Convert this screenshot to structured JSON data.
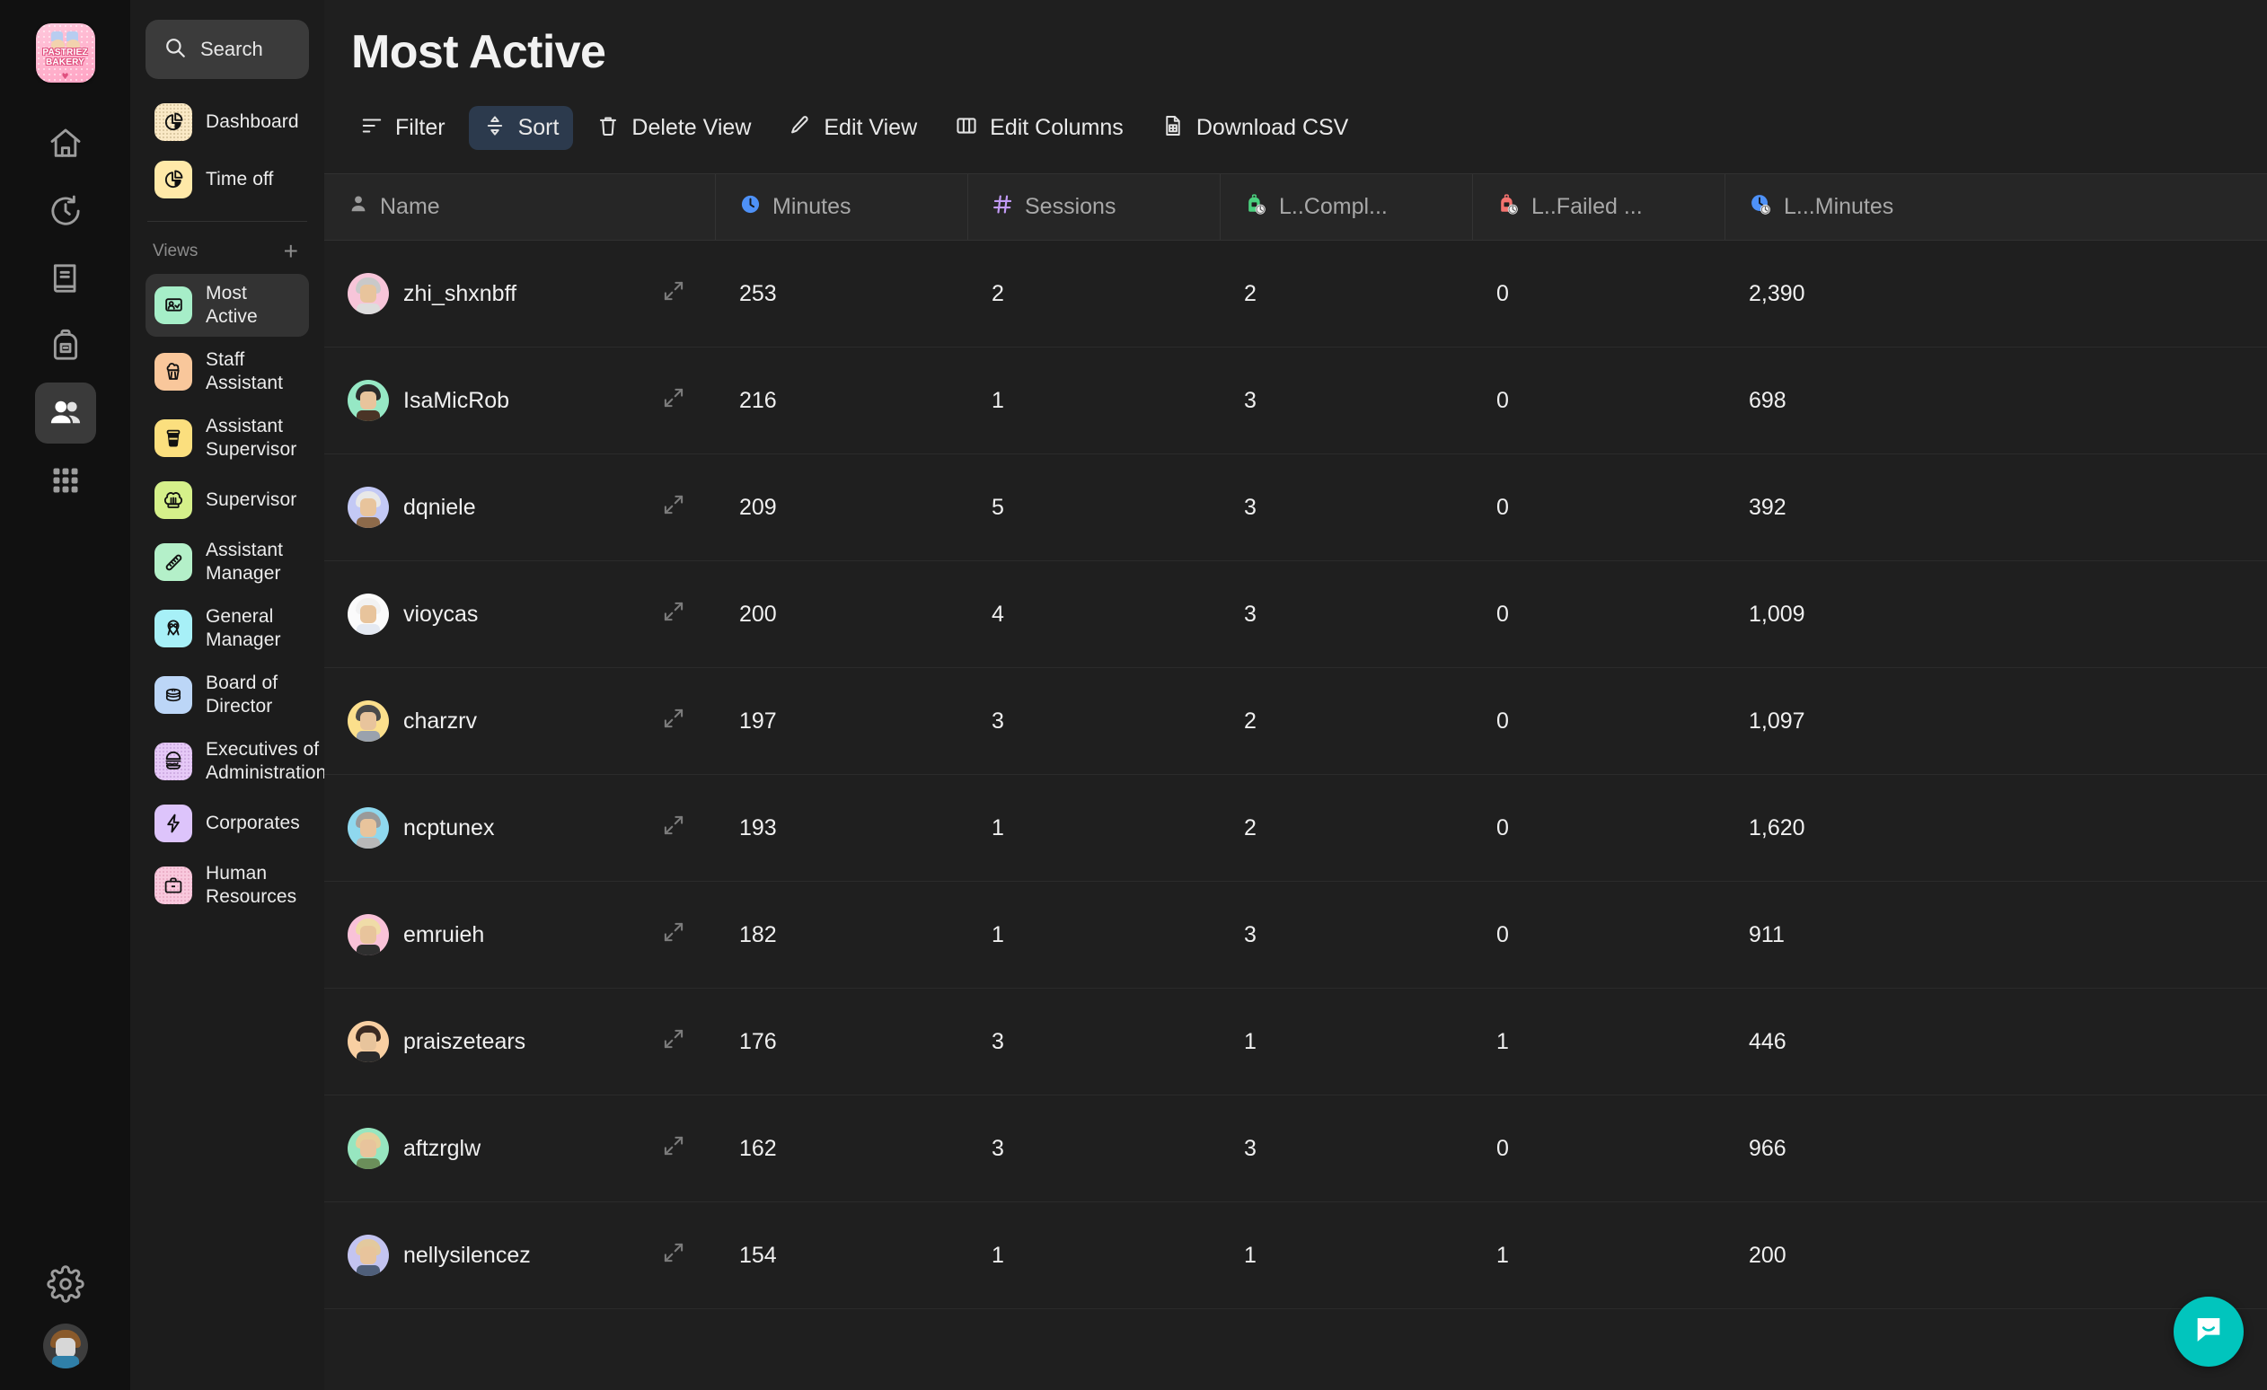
{
  "rail": {
    "brand": {
      "name": "brand-logo",
      "line1": "PASTRIEZ",
      "line2": "BAKERY"
    },
    "items": [
      {
        "name": "home-icon",
        "active": false
      },
      {
        "name": "timer-icon",
        "active": false
      },
      {
        "name": "book-icon",
        "active": false
      },
      {
        "name": "backpack-icon",
        "active": false
      },
      {
        "name": "people-icon",
        "active": true
      },
      {
        "name": "grid-apps-icon",
        "active": false
      }
    ],
    "settings": {
      "name": "gear-icon"
    },
    "avatar": {
      "name": "user-avatar"
    }
  },
  "search": {
    "placeholder": "Search",
    "icon": "search-icon"
  },
  "sidebar": {
    "nav": [
      {
        "label": "Dashboard",
        "icon": "pie-chart-icon",
        "tile": "#fae9c6",
        "textured": true
      },
      {
        "label": "Time off",
        "icon": "pie-chart-icon",
        "tile": "#ffe9a8",
        "textured": false
      }
    ],
    "views_header": {
      "label": "Views",
      "add_label": "+"
    },
    "views": [
      {
        "label": "Most Active",
        "icon": "user-presentation-icon",
        "tile": "#a6eec8",
        "selected": true
      },
      {
        "label": "Staff Assistant",
        "icon": "cupcake-icon",
        "tile": "#f9c79b",
        "selected": false
      },
      {
        "label": "Assistant Supervisor",
        "icon": "coffee-cup-icon",
        "tile": "#fbdf7e",
        "selected": false
      },
      {
        "label": "Supervisor",
        "icon": "chef-hat-icon",
        "tile": "#d5f08a",
        "selected": false
      },
      {
        "label": "Assistant Manager",
        "icon": "baguette-icon",
        "tile": "#b4f0c9",
        "selected": false
      },
      {
        "label": "General Manager",
        "icon": "location-pins-icon",
        "tile": "#a7f0f7",
        "selected": false
      },
      {
        "label": "Board of Director",
        "icon": "pancakes-icon",
        "tile": "#bcd6f7",
        "selected": false
      },
      {
        "label": "Executives of Administration",
        "icon": "burger-icon",
        "tile": "#e6c9f7",
        "selected": false
      },
      {
        "label": "Corporates",
        "icon": "lightning-bolt-icon",
        "tile": "#ddc4fb",
        "selected": false
      },
      {
        "label": "Human Resources",
        "icon": "briefcase-icon",
        "tile": "#f9c9dd",
        "selected": false
      }
    ]
  },
  "header": {
    "title": "Most Active"
  },
  "toolbar": {
    "filter": {
      "label": "Filter",
      "icon": "filter-icon",
      "active": false
    },
    "sort": {
      "label": "Sort",
      "icon": "sort-arrows-icon",
      "active": true
    },
    "delete_view": {
      "label": "Delete View",
      "icon": "trash-icon",
      "active": false
    },
    "edit_view": {
      "label": "Edit View",
      "icon": "pencil-icon",
      "active": false
    },
    "edit_columns": {
      "label": "Edit Columns",
      "icon": "columns-icon",
      "active": false
    },
    "download_csv": {
      "label": "Download CSV",
      "icon": "csv-file-icon",
      "active": false
    }
  },
  "table": {
    "columns": [
      {
        "label": "Name",
        "icon": "person-icon",
        "icon_color": "#9a9a9a"
      },
      {
        "label": "Minutes",
        "icon": "clock-icon",
        "icon_color": "#4e91f7"
      },
      {
        "label": "Sessions",
        "icon": "hash-icon",
        "icon_color": "#c39bf7"
      },
      {
        "label": "L..Compl...",
        "icon": "green-backpack-clock-icon",
        "icon_color": "#4ad07e"
      },
      {
        "label": "L..Failed ...",
        "icon": "red-backpack-clock-icon",
        "icon_color": "#f4736f"
      },
      {
        "label": "L...Minutes",
        "icon": "blue-clock-clock-icon",
        "icon_color": "#4e91f7"
      }
    ],
    "rows": [
      {
        "name": "zhi_shxnbff",
        "minutes": "253",
        "sessions": "2",
        "last_completed": "2",
        "last_failed": "0",
        "last_minutes": "2,390",
        "avatar_bg": "#f7c5d9",
        "hair": "#c9c9c9",
        "body": "#dddddd"
      },
      {
        "name": "IsaMicRob",
        "minutes": "216",
        "sessions": "1",
        "last_completed": "3",
        "last_failed": "0",
        "last_minutes": "698",
        "avatar_bg": "#96e8c5",
        "hair": "#2b2b2b",
        "body": "#4a3426"
      },
      {
        "name": "dqniele",
        "minutes": "209",
        "sessions": "5",
        "last_completed": "3",
        "last_failed": "0",
        "last_minutes": "392",
        "avatar_bg": "#c3c9f5",
        "hair": "#e8e8e8",
        "body": "#8d6a4a"
      },
      {
        "name": "vioycas",
        "minutes": "200",
        "sessions": "4",
        "last_completed": "3",
        "last_failed": "0",
        "last_minutes": "1,009",
        "avatar_bg": "#fbfbfb",
        "hair": "#f2f2f2",
        "body": "#e4e9f2"
      },
      {
        "name": "charzrv",
        "minutes": "197",
        "sessions": "3",
        "last_completed": "2",
        "last_failed": "0",
        "last_minutes": "1,097",
        "avatar_bg": "#fbdf8c",
        "hair": "#4a4a4a",
        "body": "#9aa2ad"
      },
      {
        "name": "ncptunex",
        "minutes": "193",
        "sessions": "1",
        "last_completed": "2",
        "last_failed": "0",
        "last_minutes": "1,620",
        "avatar_bg": "#8fd8ee",
        "hair": "#9a9a9a",
        "body": "#b8b8b8"
      },
      {
        "name": "emruieh",
        "minutes": "182",
        "sessions": "1",
        "last_completed": "3",
        "last_failed": "0",
        "last_minutes": "911",
        "avatar_bg": "#f9c2d8",
        "hair": "#f0dca8",
        "body": "#2f2f2f"
      },
      {
        "name": "praiszetears",
        "minutes": "176",
        "sessions": "3",
        "last_completed": "1",
        "last_failed": "1",
        "last_minutes": "446",
        "avatar_bg": "#f8cfa2",
        "hair": "#3a2a22",
        "body": "#2a2a2a"
      },
      {
        "name": "aftzrglw",
        "minutes": "162",
        "sessions": "3",
        "last_completed": "3",
        "last_failed": "0",
        "last_minutes": "966",
        "avatar_bg": "#97e6c0",
        "hair": "#e6cf9a",
        "body": "#6b8f5a"
      },
      {
        "name": "nellysilencez",
        "minutes": "154",
        "sessions": "1",
        "last_completed": "1",
        "last_failed": "1",
        "last_minutes": "200",
        "avatar_bg": "#c3c4f0",
        "hair": "#e3c99e",
        "body": "#4f5f7a"
      }
    ]
  },
  "chat_widget": {
    "icon": "chat-bubble-icon",
    "color": "#01c5bd"
  }
}
